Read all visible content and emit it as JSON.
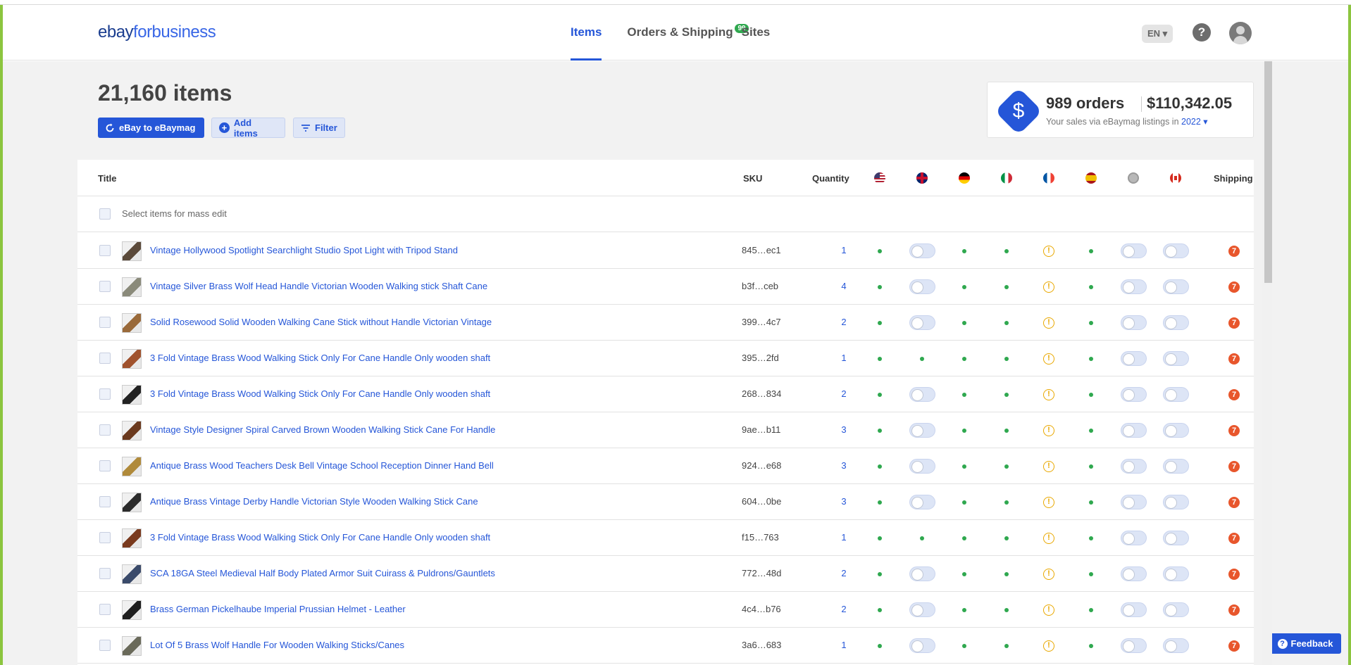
{
  "header": {
    "logo_ebay": "ebay",
    "logo_fb": "forbusiness",
    "nav": [
      {
        "label": "Items",
        "active": true
      },
      {
        "label": "Orders & Shipping",
        "badge": "99"
      },
      {
        "label": "Sites"
      }
    ],
    "lang": "EN ▾",
    "help": "?"
  },
  "summary": {
    "item_count": "21,160 items",
    "sync_label": "eBay to eBaymag",
    "add_label": "Add items",
    "filter_label": "Filter"
  },
  "sales": {
    "orders": "989 orders",
    "revenue": "$110,342.05",
    "sub_text": "Your sales via eBaymag listings in",
    "year": "2022 ▾"
  },
  "table": {
    "headers": {
      "title": "Title",
      "sku": "SKU",
      "quantity": "Quantity",
      "shipping": "Shipping"
    },
    "flags": [
      "us-flag",
      "uk-flag",
      "de-flag",
      "it-flag",
      "fr-flag",
      "es-flag",
      "globe-flag",
      "ca-flag"
    ],
    "mass_edit_label": "Select items for mass edit",
    "rows": [
      {
        "title": "Vintage Hollywood Spotlight Searchlight Studio Spot Light with Tripod Stand",
        "sku": "845…ec1",
        "qty": "1",
        "uk": "toggle"
      },
      {
        "title": "Vintage Silver Brass Wolf Head Handle Victorian Wooden Walking stick Shaft Cane",
        "sku": "b3f…ceb",
        "qty": "4",
        "uk": "toggle"
      },
      {
        "title": "Solid Rosewood Solid Wooden Walking Cane Stick without Handle Victorian Vintage",
        "sku": "399…4c7",
        "qty": "2",
        "uk": "toggle"
      },
      {
        "title": "3 Fold Vintage Brass Wood Walking Stick Only For Cane Handle Only wooden shaft",
        "sku": "395…2fd",
        "qty": "1",
        "uk": "dot"
      },
      {
        "title": "3 Fold Vintage Brass Wood Walking Stick Only For Cane Handle Only wooden shaft",
        "sku": "268…834",
        "qty": "2",
        "uk": "toggle"
      },
      {
        "title": "Vintage Style Designer Spiral Carved Brown Wooden Walking Stick Cane For Handle",
        "sku": "9ae…b11",
        "qty": "3",
        "uk": "toggle"
      },
      {
        "title": "Antique Brass Wood Teachers Desk Bell Vintage School Reception Dinner Hand Bell",
        "sku": "924…e68",
        "qty": "3",
        "uk": "toggle"
      },
      {
        "title": "Antique Brass Vintage Derby Handle Victorian Style Wooden Walking Stick Cane",
        "sku": "604…0be",
        "qty": "3",
        "uk": "toggle"
      },
      {
        "title": "3 Fold Vintage Brass Wood Walking Stick Only For Cane Handle Only wooden shaft",
        "sku": "f15…763",
        "qty": "1",
        "uk": "dot"
      },
      {
        "title": "SCA 18GA Steel Medieval Half Body Plated Armor Suit Cuirass & Puldrons/Gauntlets",
        "sku": "772…48d",
        "qty": "2",
        "uk": "toggle"
      },
      {
        "title": "Brass German Pickelhaube Imperial Prussian Helmet - Leather",
        "sku": "4c4…b76",
        "qty": "2",
        "uk": "toggle"
      },
      {
        "title": "Lot Of 5 Brass Wolf Handle For Wooden Walking Sticks/Canes",
        "sku": "3a6…683",
        "qty": "1",
        "uk": "toggle"
      }
    ],
    "warn_glyph": "!",
    "ship_glyph": "7"
  },
  "feedback": {
    "label": "Feedback",
    "glyph": "?"
  },
  "colors": {
    "accent": "#2556d8",
    "ok": "#2fa84f",
    "warn": "#e9a800",
    "ship": "#e8562c",
    "frame": "#8cc53f"
  }
}
